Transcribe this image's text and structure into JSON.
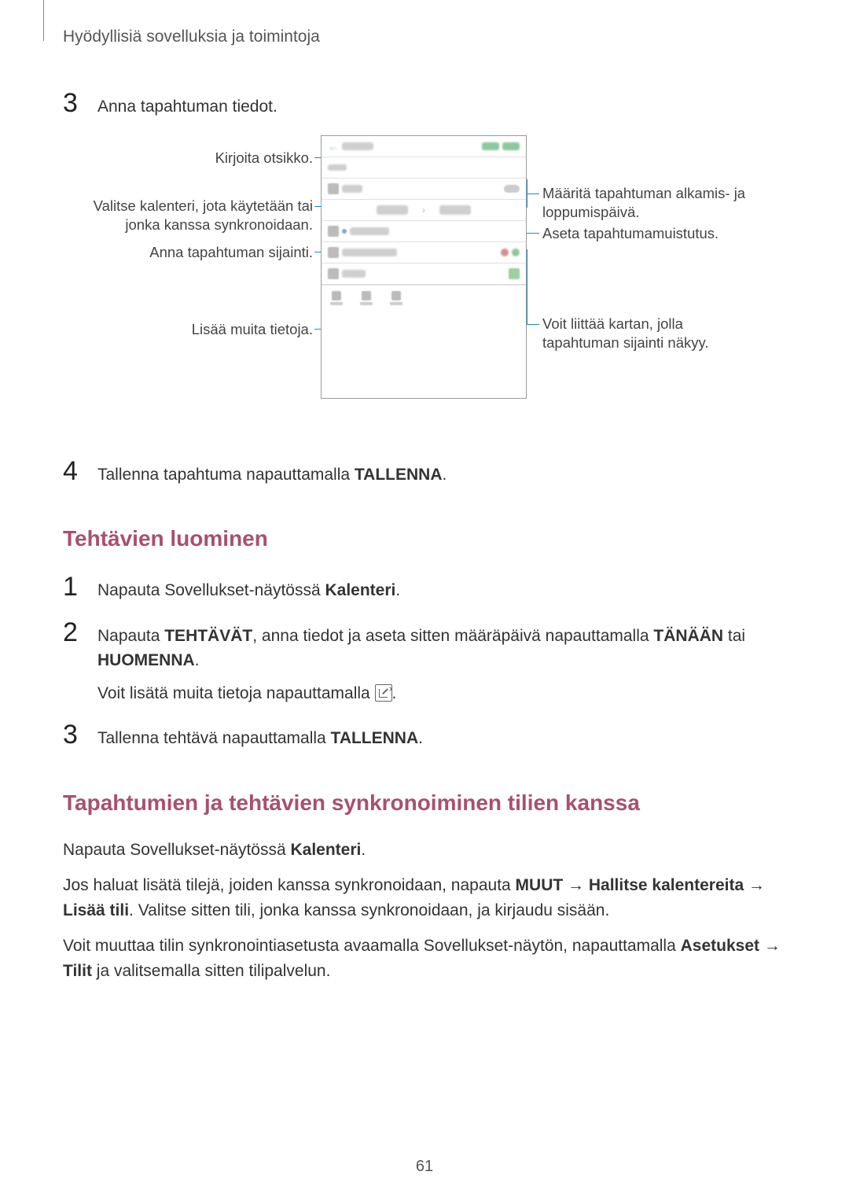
{
  "header": "Hyödyllisiä sovelluksia ja toimintoja",
  "step3": {
    "num": "3",
    "text": "Anna tapahtuman tiedot."
  },
  "callouts": {
    "title": "Kirjoita otsikko.",
    "calendar": "Valitse kalenteri, jota käytetään tai jonka kanssa synkronoidaan.",
    "location": "Anna tapahtuman sijainti.",
    "more": "Lisää muita tietoja.",
    "dates": "Määritä tapahtuman alkamis- ja loppumispäivä.",
    "reminder": "Aseta tapahtumamuistutus.",
    "map": "Voit liittää kartan, jolla tapahtuman sijainti näkyy."
  },
  "step4": {
    "num": "4",
    "pre": "Tallenna tapahtuma napauttamalla ",
    "bold": "TALLENNA",
    "post": "."
  },
  "h2a": "Tehtävien luominen",
  "t1": {
    "num": "1",
    "pre": "Napauta Sovellukset-näytössä ",
    "b1": "Kalenteri",
    "post": "."
  },
  "t2": {
    "num": "2",
    "p1_pre": "Napauta ",
    "p1_b1": "TEHTÄVÄT",
    "p1_mid": ", anna tiedot ja aseta sitten määräpäivä napauttamalla ",
    "p1_b2": "TÄNÄÄN",
    "p1_or": " tai ",
    "p1_b3": "HUOMENNA",
    "p1_post": ".",
    "p2_pre": "Voit lisätä muita tietoja napauttamalla ",
    "p2_post": "."
  },
  "t3": {
    "num": "3",
    "pre": "Tallenna tehtävä napauttamalla ",
    "b1": "TALLENNA",
    "post": "."
  },
  "h2b": "Tapahtumien ja tehtävien synkronoiminen tilien kanssa",
  "sync": {
    "p1_pre": "Napauta Sovellukset-näytössä ",
    "p1_b": "Kalenteri",
    "p1_post": ".",
    "p2_pre": "Jos haluat lisätä tilejä, joiden kanssa synkronoidaan, napauta ",
    "p2_b1": "MUUT",
    "p2_arrow1": " → ",
    "p2_b2": "Hallitse kalentereita",
    "p2_arrow2": " → ",
    "p2_b3": "Lisää tili",
    "p2_post": ". Valitse sitten tili, jonka kanssa synkronoidaan, ja kirjaudu sisään.",
    "p3_pre": "Voit muuttaa tilin synkronointiasetusta avaamalla Sovellukset-näytön, napauttamalla ",
    "p3_b1": "Asetukset",
    "p3_arrow": " → ",
    "p3_b2": "Tilit",
    "p3_post": " ja valitsemalla sitten tilipalvelun."
  },
  "pagenum": "61"
}
